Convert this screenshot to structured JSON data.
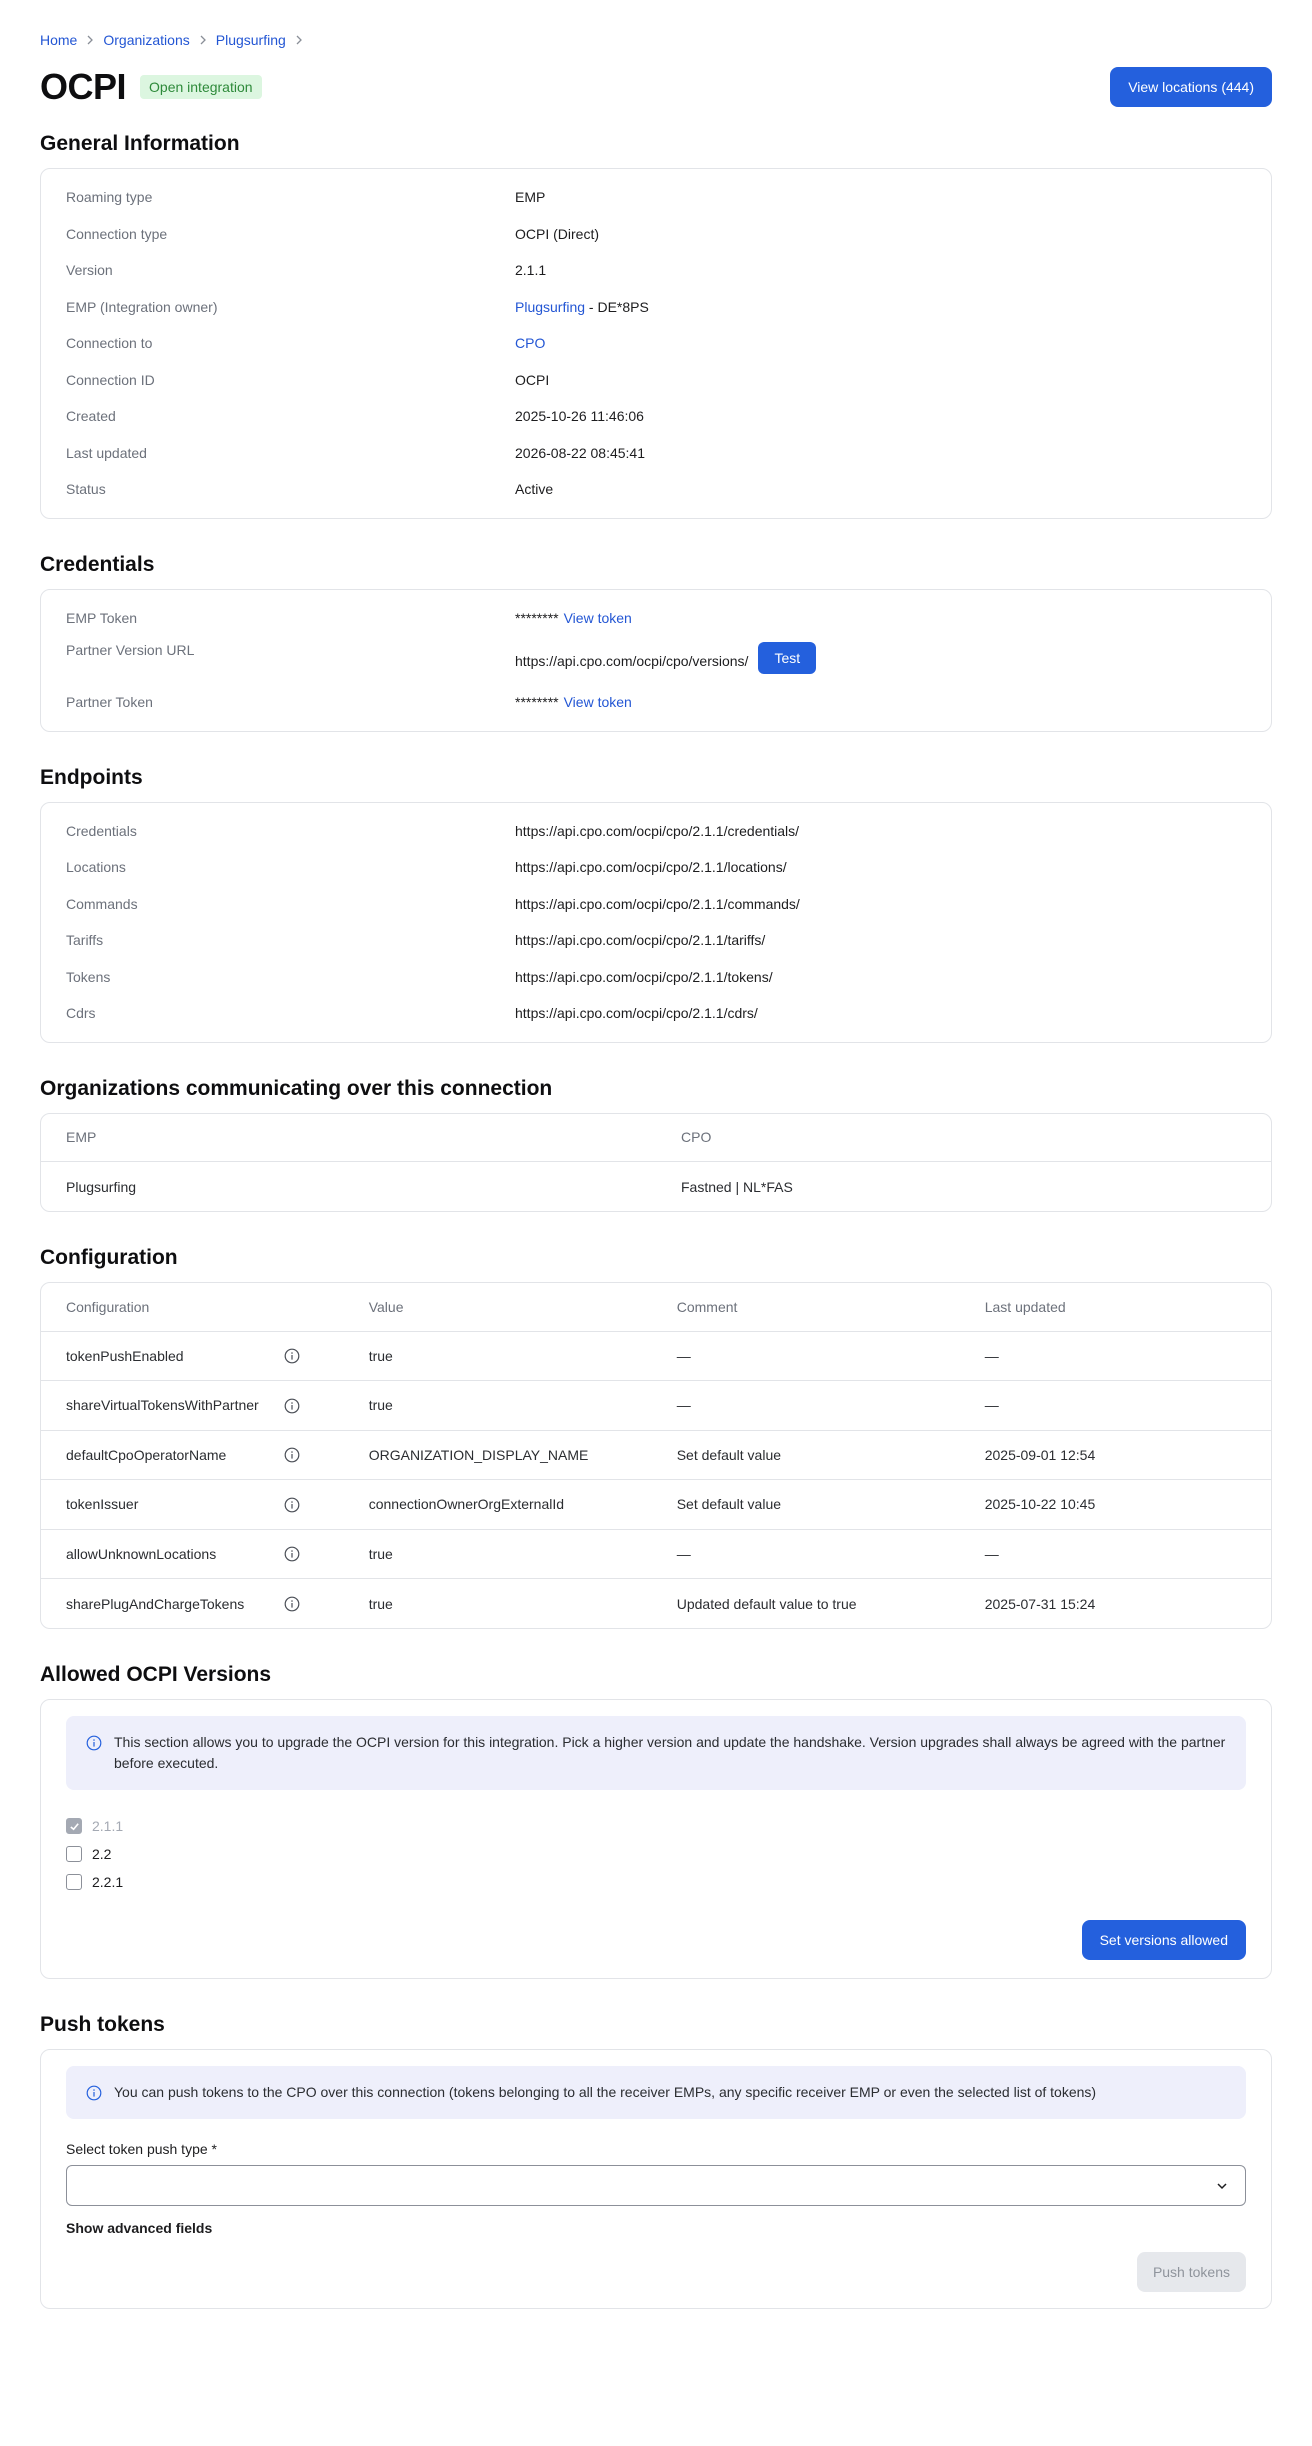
{
  "breadcrumb": {
    "items": [
      "Home",
      "Organizations",
      "Plugsurfing"
    ]
  },
  "header": {
    "title": "OCPI",
    "badge": "Open integration",
    "view_locations_label": "View locations (444)"
  },
  "general": {
    "title": "General Information",
    "rows": [
      {
        "label": "Roaming type",
        "value": "EMP"
      },
      {
        "label": "Connection type",
        "value": "OCPI (Direct)"
      },
      {
        "label": "Version",
        "value": "2.1.1"
      },
      {
        "label": "EMP (Integration owner)",
        "link": "Plugsurfing",
        "suffix": " - DE*8PS"
      },
      {
        "label": "Connection to",
        "link": "CPO"
      },
      {
        "label": "Connection ID",
        "value": "OCPI"
      },
      {
        "label": "Created",
        "value": "2025-10-26 11:46:06"
      },
      {
        "label": "Last updated",
        "value": "2026-08-22 08:45:41"
      },
      {
        "label": "Status",
        "value": "Active"
      }
    ]
  },
  "credentials": {
    "title": "Credentials",
    "emp_token_label": "EMP Token",
    "emp_token_masked": "********",
    "view_token_label": "View token",
    "partner_url_label": "Partner Version URL",
    "partner_url": "https://api.cpo.com/ocpi/cpo/versions/",
    "test_label": "Test",
    "partner_token_label": "Partner Token",
    "partner_token_masked": "********"
  },
  "endpoints": {
    "title": "Endpoints",
    "rows": [
      {
        "label": "Credentials",
        "value": "https://api.cpo.com/ocpi/cpo/2.1.1/credentials/"
      },
      {
        "label": "Locations",
        "value": "https://api.cpo.com/ocpi/cpo/2.1.1/locations/"
      },
      {
        "label": "Commands",
        "value": "https://api.cpo.com/ocpi/cpo/2.1.1/commands/"
      },
      {
        "label": "Tariffs",
        "value": "https://api.cpo.com/ocpi/cpo/2.1.1/tariffs/"
      },
      {
        "label": "Tokens",
        "value": "https://api.cpo.com/ocpi/cpo/2.1.1/tokens/"
      },
      {
        "label": "Cdrs",
        "value": "https://api.cpo.com/ocpi/cpo/2.1.1/cdrs/"
      }
    ]
  },
  "organizations": {
    "title": "Organizations communicating over this connection",
    "columns": [
      "EMP",
      "CPO"
    ],
    "rows": [
      [
        "Plugsurfing",
        "Fastned | NL*FAS"
      ]
    ]
  },
  "configuration": {
    "title": "Configuration",
    "columns": [
      "Configuration",
      "Value",
      "Comment",
      "Last updated"
    ],
    "rows": [
      {
        "name": "tokenPushEnabled",
        "value": "true",
        "comment": "—",
        "updated": "—"
      },
      {
        "name": "shareVirtualTokensWithPartner",
        "value": "true",
        "comment": "—",
        "updated": "—"
      },
      {
        "name": "defaultCpoOperatorName",
        "value": "ORGANIZATION_DISPLAY_NAME",
        "comment": "Set default value",
        "updated": "2025-09-01 12:54"
      },
      {
        "name": "tokenIssuer",
        "value": "connectionOwnerOrgExternalId",
        "comment": "Set default value",
        "updated": "2025-10-22 10:45"
      },
      {
        "name": "allowUnknownLocations",
        "value": "true",
        "comment": "—",
        "updated": "—"
      },
      {
        "name": "sharePlugAndChargeTokens",
        "value": "true",
        "comment": "Updated default value to true",
        "updated": "2025-07-31 15:24"
      }
    ]
  },
  "versions": {
    "title": "Allowed OCPI Versions",
    "info": "This section allows you to upgrade the OCPI version for this integration. Pick a higher version and update the handshake. Version upgrades shall always be agreed with the partner before executed.",
    "options": [
      {
        "label": "2.1.1",
        "checked": true,
        "disabled": true
      },
      {
        "label": "2.2",
        "checked": false,
        "disabled": false
      },
      {
        "label": "2.2.1",
        "checked": false,
        "disabled": false
      }
    ],
    "submit_label": "Set versions allowed"
  },
  "push_tokens": {
    "title": "Push tokens",
    "info": "You can push tokens to the CPO over this connection (tokens belonging to all the receiver EMPs, any specific receiver EMP or even the selected list of tokens)",
    "select_label": "Select token push type",
    "required_mark": "*",
    "select_value": "",
    "advanced_label": "Show advanced fields",
    "submit_label": "Push tokens"
  },
  "colors": {
    "primary": "#2460dd",
    "link": "#2356d4",
    "badge_bg": "#dcf6e0",
    "badge_text": "#2e8a3a",
    "info_bg": "#eeeffb"
  },
  "icons": {
    "breadcrumb_separator": "chevron-right-icon",
    "row_info": "info-circle-icon",
    "select": "chevron-down-icon",
    "checkbox_checked": "check-icon"
  }
}
